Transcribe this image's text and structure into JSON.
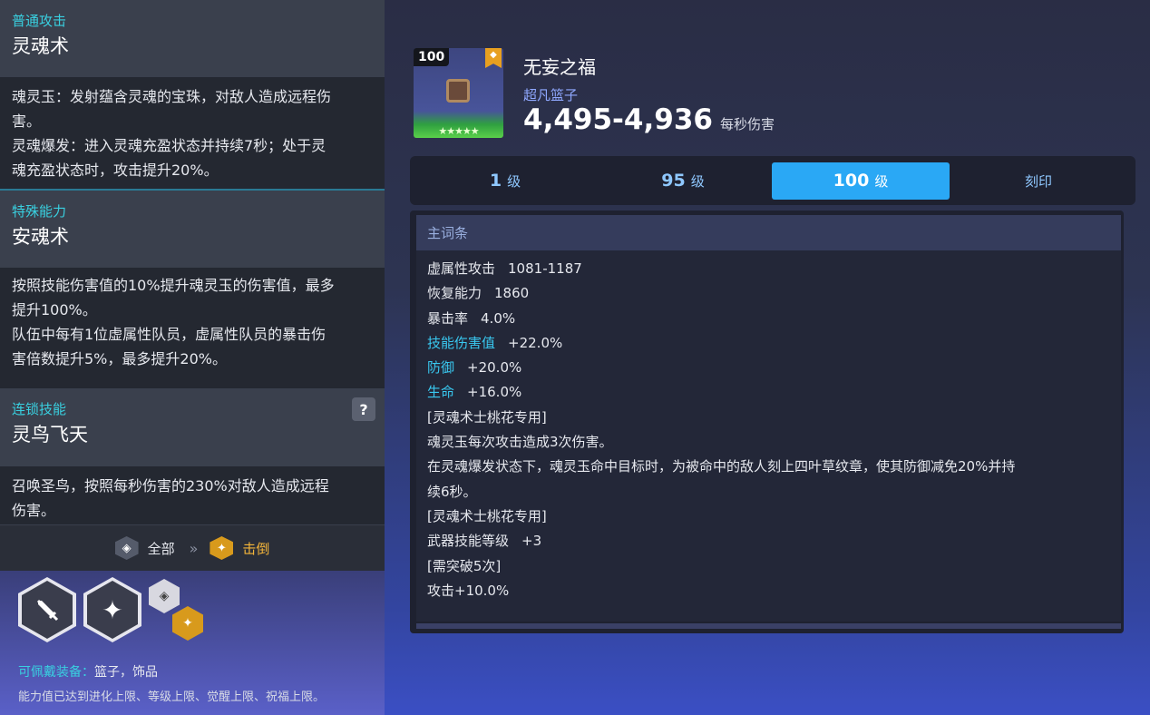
{
  "skills": [
    {
      "category": "普通攻击",
      "name": "灵魂术",
      "desc": [
        "魂灵玉：发射蕴含灵魂的宝珠，对敌人造成远程伤",
        "害。",
        "灵魂爆发：进入灵魂充盈状态并持续7秒；处于灵",
        "魂充盈状态时，攻击提升20%。"
      ]
    },
    {
      "category": "特殊能力",
      "name": "安魂术",
      "desc": [
        "按照技能伤害值的10%提升魂灵玉的伤害值，最多",
        "提升100%。",
        "队伍中每有1位虚属性队员，虚属性队员的暴击伤",
        "害倍数提升5%，最多提升20%。"
      ]
    },
    {
      "category": "连锁技能",
      "name": "灵鸟飞天",
      "help": "?",
      "desc": [
        "召唤圣鸟，按照每秒伤害的230%对敌人造成远程",
        "伤害。"
      ]
    }
  ],
  "chain": {
    "from_label": "全部",
    "to_label": "击倒",
    "from_icon": "all-elements-icon",
    "to_icon": "knockdown-icon",
    "arrows": "»"
  },
  "equip": {
    "label": "可佩戴装备：",
    "value": "篮子，饰品",
    "limits": "能力值已达到进化上限、等级上限、觉醒上限、祝福上限。",
    "icons": [
      "sword-icon",
      "sparkle-icon",
      "all-elements-icon",
      "knockdown-icon"
    ]
  },
  "item": {
    "level": "100",
    "name": "无妄之福",
    "type": "超凡篮子",
    "dps": "4,495-4,936",
    "dps_unit": "每秒伤害",
    "stars": "★★★★★",
    "bookmark_icon": "bookmark-icon"
  },
  "tabs": [
    {
      "num": "1",
      "unit": "级",
      "active": false
    },
    {
      "num": "95",
      "unit": "级",
      "active": false
    },
    {
      "num": "100",
      "unit": "级",
      "active": true
    },
    {
      "num": "",
      "unit": "刻印",
      "active": false
    }
  ],
  "stats": {
    "header": "主词条",
    "lines": [
      {
        "k": "虚属性攻击",
        "v": "1081-1187",
        "hl": false
      },
      {
        "k": "恢复能力",
        "v": "1860",
        "hl": false
      },
      {
        "k": "暴击率",
        "v": "4.0%",
        "hl": false
      },
      {
        "k": "技能伤害值",
        "v": "+22.0%",
        "hl": true
      },
      {
        "k": "防御",
        "v": "+20.0%",
        "hl": true
      },
      {
        "k": "生命",
        "v": "+16.0%",
        "hl": true
      },
      {
        "k": "[灵魂术士桃花专用]",
        "v": "",
        "hl": false
      },
      {
        "k": "魂灵玉每次攻击造成3次伤害。",
        "v": "",
        "hl": false
      },
      {
        "k": "在灵魂爆发状态下，魂灵玉命中目标时，为被命中的敌人刻上四叶草纹章，使其防御减免20%并持",
        "v": "",
        "hl": false
      },
      {
        "k": "续6秒。",
        "v": "",
        "hl": false
      },
      {
        "k": "[灵魂术士桃花专用]",
        "v": "",
        "hl": false
      },
      {
        "k": "武器技能等级",
        "v": "+3",
        "hl": false
      },
      {
        "k": "[需突破5次]",
        "v": "",
        "hl": false
      },
      {
        "k": "攻击+10.0%",
        "v": "",
        "hl": false
      }
    ]
  },
  "colors": {
    "accent_cyan": "#39d0e0",
    "tab_active": "#2aa8f5",
    "gold": "#f2b43a"
  }
}
